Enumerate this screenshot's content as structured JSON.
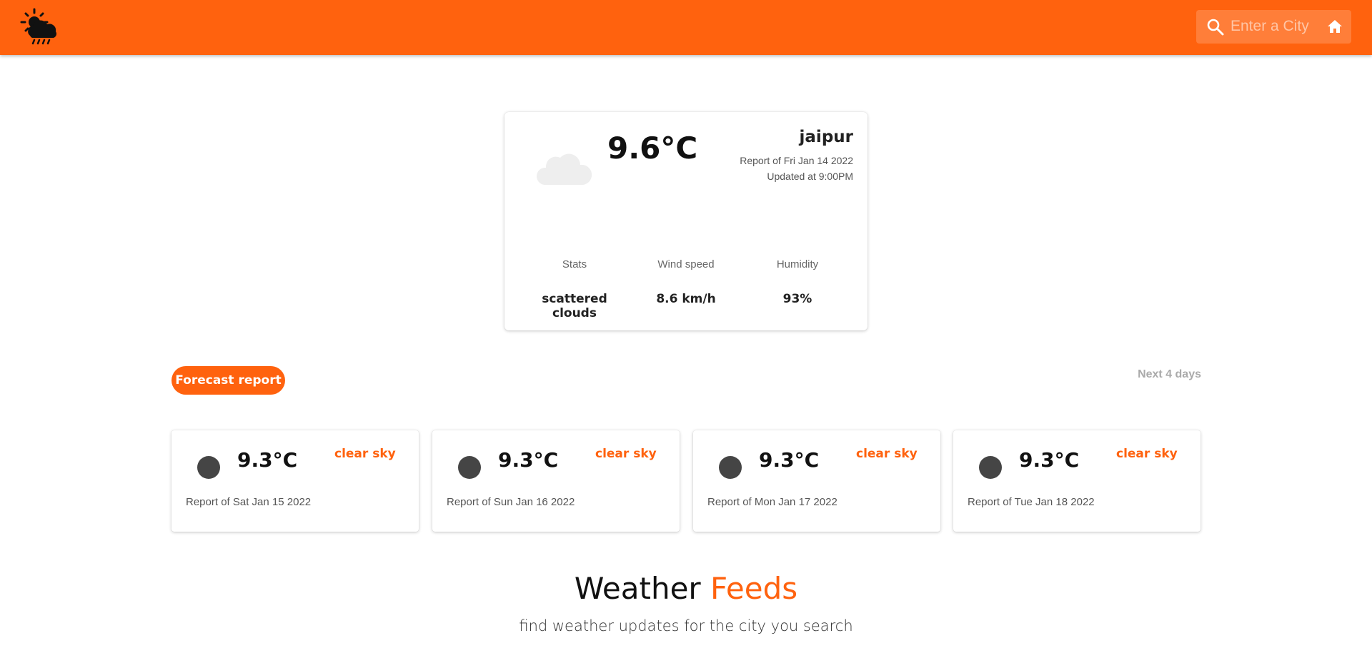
{
  "colors": {
    "accent": "#ff620e",
    "forecast_dot": "#454545"
  },
  "header": {
    "logo_icon": "sun-cloud-rain-icon",
    "search": {
      "icon": "search-icon",
      "placeholder": "Enter a City",
      "value": ""
    },
    "home_icon": "home-icon"
  },
  "current": {
    "icon": "cloud-icon",
    "temperature": "9.6°C",
    "city": "jaipur",
    "report_date": "Report of Fri Jan 14 2022",
    "updated_at": "Updated at 9:00PM",
    "stats": [
      {
        "label": "Stats",
        "value": "scattered clouds"
      },
      {
        "label": "Wind speed",
        "value": "8.6 km/h"
      },
      {
        "label": "Humidity",
        "value": "93%"
      }
    ]
  },
  "forecast": {
    "button_label": "Forecast report",
    "range_label": "Next 4 days",
    "days": [
      {
        "temperature": "9.3°C",
        "description": "clear sky",
        "report": "Report of Sat Jan 15 2022"
      },
      {
        "temperature": "9.3°C",
        "description": "clear sky",
        "report": "Report of Sun Jan 16 2022"
      },
      {
        "temperature": "9.3°C",
        "description": "clear sky",
        "report": "Report of Mon Jan 17 2022"
      },
      {
        "temperature": "9.3°C",
        "description": "clear sky",
        "report": "Report of Tue Jan 18 2022"
      }
    ]
  },
  "feeds": {
    "title_part1": "Weather",
    "title_part2": "Feeds",
    "subtitle": "find weather updates for the city you search"
  }
}
